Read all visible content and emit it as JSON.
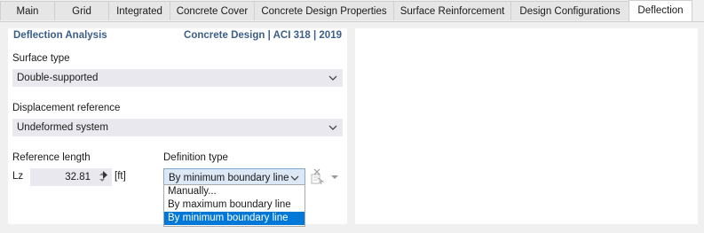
{
  "tabs": [
    {
      "label": "Main"
    },
    {
      "label": "Grid"
    },
    {
      "label": "Integrated"
    },
    {
      "label": "Concrete Cover"
    },
    {
      "label": "Concrete Design Properties"
    },
    {
      "label": "Surface Reinforcement"
    },
    {
      "label": "Design Configurations"
    },
    {
      "label": "Deflection"
    }
  ],
  "active_tab": "Deflection",
  "section": {
    "title": "Deflection Analysis",
    "standard": "Concrete Design | ACI 318 | 2019"
  },
  "surface_type": {
    "label": "Surface type",
    "value": "Double-supported"
  },
  "displacement_reference": {
    "label": "Displacement reference",
    "value": "Undeformed system"
  },
  "reference_length": {
    "label": "Reference length",
    "symbol": "Lz",
    "value": "32.81",
    "unit": "[ft]"
  },
  "definition_type": {
    "label": "Definition type",
    "value": "By minimum boundary line",
    "options": [
      "Manually...",
      "By maximum boundary line",
      "By minimum boundary line"
    ],
    "selected_index": 2
  },
  "icons": {
    "chevron": "chevron-down-icon",
    "spinner": "spinner-arrows-icon",
    "pick": "pick-from-model-icon"
  },
  "colors": {
    "header_text": "#3b5e8a",
    "selection": "#0078d7",
    "field_bg": "#e8e8ee"
  }
}
